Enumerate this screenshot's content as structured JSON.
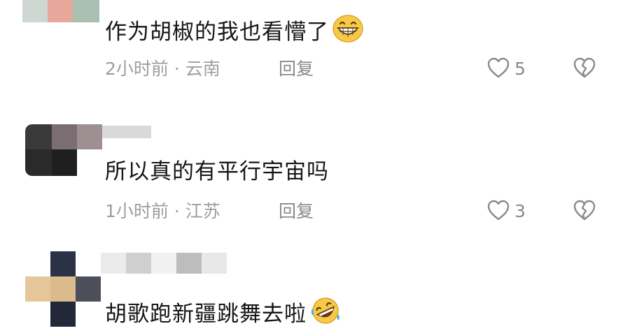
{
  "comments": [
    {
      "text": "作为胡椒的我也看懵了",
      "emoji_icon": "grinning-face-icon",
      "time": "2小时前",
      "separator": " · ",
      "location": "云南",
      "reply_label": "回复",
      "likes": "5"
    },
    {
      "text": "所以真的有平行宇宙吗",
      "time": "1小时前",
      "separator": " · ",
      "location": "江苏",
      "reply_label": "回复",
      "likes": "3"
    },
    {
      "text": "胡歌跑新疆跳舞去啦",
      "emoji_icon": "rolling-on-floor-laughing-icon"
    }
  ],
  "colors": {
    "text": "#161616",
    "meta": "#9e9e9e",
    "icon": "#8a8a8a"
  }
}
